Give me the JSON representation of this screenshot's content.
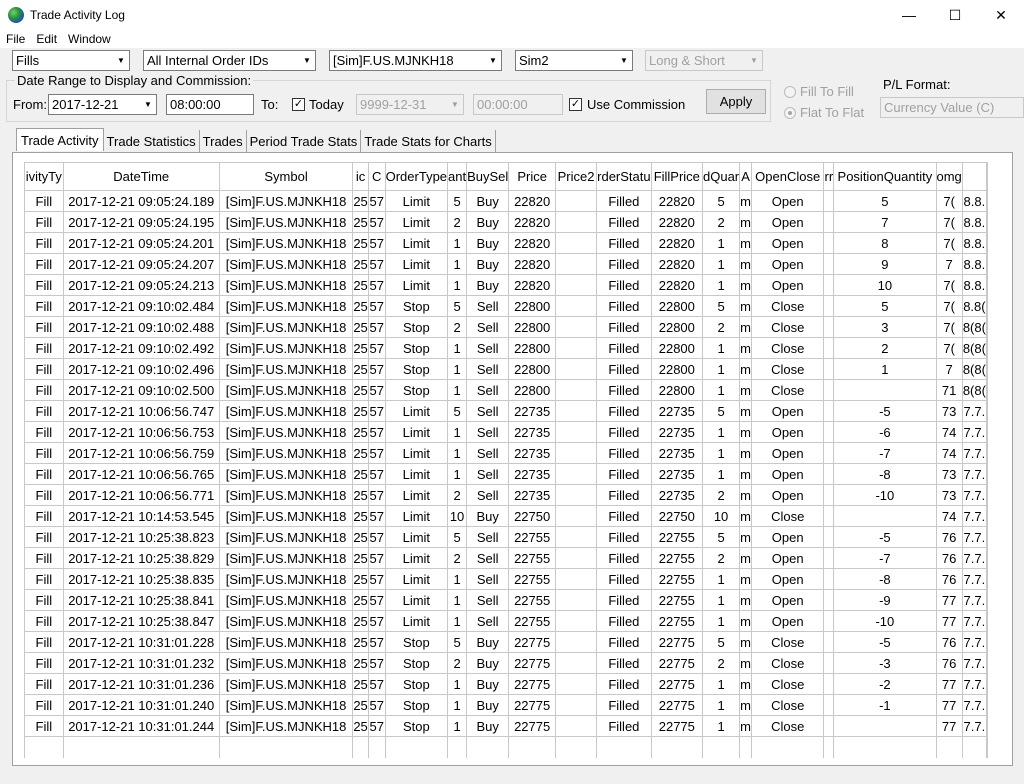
{
  "window": {
    "title": "Trade Activity Log",
    "controls": {
      "minimize": "—",
      "maximize": "☐",
      "close": "✕"
    }
  },
  "menu": [
    "File",
    "Edit",
    "Window"
  ],
  "toolbar": {
    "data_type": "Fills",
    "order_ids": "All Internal Order IDs",
    "symbol": "[Sim]F.US.MJNKH18",
    "account": "Sim2",
    "side": "Long & Short"
  },
  "date_range": {
    "legend": "Date Range to Display and Commission:",
    "from_label": "From:",
    "from_date": "2017-12-21",
    "from_time": "08:00:00",
    "to_label": "To:",
    "today_label": "Today",
    "today_checked": true,
    "to_date": "9999-12-31",
    "to_time": "00:00:00",
    "use_commission_label": "Use Commission",
    "use_commission_checked": true,
    "apply_label": "Apply"
  },
  "fill_options": {
    "fill_to_fill": "Fill To Fill",
    "flat_to_flat": "Flat To Flat"
  },
  "pl_format": {
    "label": "P/L Format:",
    "value": "Currency Value (C)"
  },
  "tabs": [
    "Trade Activity",
    "Trade Statistics",
    "Trades",
    "Period Trade Stats",
    "Trade Stats for Charts"
  ],
  "grid": {
    "columns": [
      "ivityTy",
      "DateTime",
      "Symbol",
      "ic",
      "C",
      "OrderType",
      "ant",
      "BuySel",
      "Price",
      "Price2",
      "rderStatu",
      "FillPrice",
      "dQuar",
      "A",
      "OpenClose",
      "rr",
      "PositionQuantity",
      "omg",
      ""
    ],
    "rows": [
      [
        "Fill",
        "2017-12-21  09:05:24.189",
        "[Sim]F.US.MJNKH18",
        "25",
        "57",
        "Limit",
        "5",
        "Buy",
        "22820",
        "",
        "Filled",
        "22820",
        "5",
        "m",
        "Open",
        "",
        "5",
        "7(",
        "8.8."
      ],
      [
        "Fill",
        "2017-12-21  09:05:24.195",
        "[Sim]F.US.MJNKH18",
        "25",
        "57",
        "Limit",
        "2",
        "Buy",
        "22820",
        "",
        "Filled",
        "22820",
        "2",
        "m",
        "Open",
        "",
        "7",
        "7(",
        "8.8."
      ],
      [
        "Fill",
        "2017-12-21  09:05:24.201",
        "[Sim]F.US.MJNKH18",
        "25",
        "57",
        "Limit",
        "1",
        "Buy",
        "22820",
        "",
        "Filled",
        "22820",
        "1",
        "m",
        "Open",
        "",
        "8",
        "7(",
        "8.8."
      ],
      [
        "Fill",
        "2017-12-21  09:05:24.207",
        "[Sim]F.US.MJNKH18",
        "25",
        "57",
        "Limit",
        "1",
        "Buy",
        "22820",
        "",
        "Filled",
        "22820",
        "1",
        "m",
        "Open",
        "",
        "9",
        "7",
        "8.8."
      ],
      [
        "Fill",
        "2017-12-21  09:05:24.213",
        "[Sim]F.US.MJNKH18",
        "25",
        "57",
        "Limit",
        "1",
        "Buy",
        "22820",
        "",
        "Filled",
        "22820",
        "1",
        "m",
        "Open",
        "",
        "10",
        "7(",
        "8.8."
      ],
      [
        "Fill",
        "2017-12-21  09:10:02.484",
        "[Sim]F.US.MJNKH18",
        "25",
        "57",
        "Stop",
        "5",
        "Sell",
        "22800",
        "",
        "Filled",
        "22800",
        "5",
        "m",
        "Close",
        "",
        "5",
        "7(",
        "8.8("
      ],
      [
        "Fill",
        "2017-12-21  09:10:02.488",
        "[Sim]F.US.MJNKH18",
        "25",
        "57",
        "Stop",
        "2",
        "Sell",
        "22800",
        "",
        "Filled",
        "22800",
        "2",
        "m",
        "Close",
        "",
        "3",
        "7(",
        "8(8("
      ],
      [
        "Fill",
        "2017-12-21  09:10:02.492",
        "[Sim]F.US.MJNKH18",
        "25",
        "57",
        "Stop",
        "1",
        "Sell",
        "22800",
        "",
        "Filled",
        "22800",
        "1",
        "m",
        "Close",
        "",
        "2",
        "7(",
        "8(8("
      ],
      [
        "Fill",
        "2017-12-21  09:10:02.496",
        "[Sim]F.US.MJNKH18",
        "25",
        "57",
        "Stop",
        "1",
        "Sell",
        "22800",
        "",
        "Filled",
        "22800",
        "1",
        "m",
        "Close",
        "",
        "1",
        "7",
        "8(8("
      ],
      [
        "Fill",
        "2017-12-21  09:10:02.500",
        "[Sim]F.US.MJNKH18",
        "25",
        "57",
        "Stop",
        "1",
        "Sell",
        "22800",
        "",
        "Filled",
        "22800",
        "1",
        "m",
        "Close",
        "",
        "",
        "71",
        "8(8("
      ],
      [
        "Fill",
        "2017-12-21  10:06:56.747",
        "[Sim]F.US.MJNKH18",
        "25",
        "57",
        "Limit",
        "5",
        "Sell",
        "22735",
        "",
        "Filled",
        "22735",
        "5",
        "m",
        "Open",
        "",
        "-5",
        "73",
        "7.7."
      ],
      [
        "Fill",
        "2017-12-21  10:06:56.753",
        "[Sim]F.US.MJNKH18",
        "25",
        "57",
        "Limit",
        "1",
        "Sell",
        "22735",
        "",
        "Filled",
        "22735",
        "1",
        "m",
        "Open",
        "",
        "-6",
        "74",
        "7.7."
      ],
      [
        "Fill",
        "2017-12-21  10:06:56.759",
        "[Sim]F.US.MJNKH18",
        "25",
        "57",
        "Limit",
        "1",
        "Sell",
        "22735",
        "",
        "Filled",
        "22735",
        "1",
        "m",
        "Open",
        "",
        "-7",
        "74",
        "7.7."
      ],
      [
        "Fill",
        "2017-12-21  10:06:56.765",
        "[Sim]F.US.MJNKH18",
        "25",
        "57",
        "Limit",
        "1",
        "Sell",
        "22735",
        "",
        "Filled",
        "22735",
        "1",
        "m",
        "Open",
        "",
        "-8",
        "73",
        "7.7."
      ],
      [
        "Fill",
        "2017-12-21  10:06:56.771",
        "[Sim]F.US.MJNKH18",
        "25",
        "57",
        "Limit",
        "2",
        "Sell",
        "22735",
        "",
        "Filled",
        "22735",
        "2",
        "m",
        "Open",
        "",
        "-10",
        "73",
        "7.7."
      ],
      [
        "Fill",
        "2017-12-21  10:14:53.545",
        "[Sim]F.US.MJNKH18",
        "25",
        "57",
        "Limit",
        "10",
        "Buy",
        "22750",
        "",
        "Filled",
        "22750",
        "10",
        "m",
        "Close",
        "",
        "",
        "74",
        "7.7."
      ],
      [
        "Fill",
        "2017-12-21  10:25:38.823",
        "[Sim]F.US.MJNKH18",
        "25",
        "57",
        "Limit",
        "5",
        "Sell",
        "22755",
        "",
        "Filled",
        "22755",
        "5",
        "m",
        "Open",
        "",
        "-5",
        "76",
        "7.7."
      ],
      [
        "Fill",
        "2017-12-21  10:25:38.829",
        "[Sim]F.US.MJNKH18",
        "25",
        "57",
        "Limit",
        "2",
        "Sell",
        "22755",
        "",
        "Filled",
        "22755",
        "2",
        "m",
        "Open",
        "",
        "-7",
        "76",
        "7.7."
      ],
      [
        "Fill",
        "2017-12-21  10:25:38.835",
        "[Sim]F.US.MJNKH18",
        "25",
        "57",
        "Limit",
        "1",
        "Sell",
        "22755",
        "",
        "Filled",
        "22755",
        "1",
        "m",
        "Open",
        "",
        "-8",
        "76",
        "7.7."
      ],
      [
        "Fill",
        "2017-12-21  10:25:38.841",
        "[Sim]F.US.MJNKH18",
        "25",
        "57",
        "Limit",
        "1",
        "Sell",
        "22755",
        "",
        "Filled",
        "22755",
        "1",
        "m",
        "Open",
        "",
        "-9",
        "77",
        "7.7."
      ],
      [
        "Fill",
        "2017-12-21  10:25:38.847",
        "[Sim]F.US.MJNKH18",
        "25",
        "57",
        "Limit",
        "1",
        "Sell",
        "22755",
        "",
        "Filled",
        "22755",
        "1",
        "m",
        "Open",
        "",
        "-10",
        "77",
        "7.7."
      ],
      [
        "Fill",
        "2017-12-21  10:31:01.228",
        "[Sim]F.US.MJNKH18",
        "25",
        "57",
        "Stop",
        "5",
        "Buy",
        "22775",
        "",
        "Filled",
        "22775",
        "5",
        "m",
        "Close",
        "",
        "-5",
        "76",
        "7.7."
      ],
      [
        "Fill",
        "2017-12-21  10:31:01.232",
        "[Sim]F.US.MJNKH18",
        "25",
        "57",
        "Stop",
        "2",
        "Buy",
        "22775",
        "",
        "Filled",
        "22775",
        "2",
        "m",
        "Close",
        "",
        "-3",
        "76",
        "7.7."
      ],
      [
        "Fill",
        "2017-12-21  10:31:01.236",
        "[Sim]F.US.MJNKH18",
        "25",
        "57",
        "Stop",
        "1",
        "Buy",
        "22775",
        "",
        "Filled",
        "22775",
        "1",
        "m",
        "Close",
        "",
        "-2",
        "77",
        "7.7."
      ],
      [
        "Fill",
        "2017-12-21  10:31:01.240",
        "[Sim]F.US.MJNKH18",
        "25",
        "57",
        "Stop",
        "1",
        "Buy",
        "22775",
        "",
        "Filled",
        "22775",
        "1",
        "m",
        "Close",
        "",
        "-1",
        "77",
        "7.7."
      ],
      [
        "Fill",
        "2017-12-21  10:31:01.244",
        "[Sim]F.US.MJNKH18",
        "25",
        "57",
        "Stop",
        "1",
        "Buy",
        "22775",
        "",
        "Filled",
        "22775",
        "1",
        "m",
        "Close",
        "",
        "",
        "77",
        "7.7."
      ]
    ]
  }
}
